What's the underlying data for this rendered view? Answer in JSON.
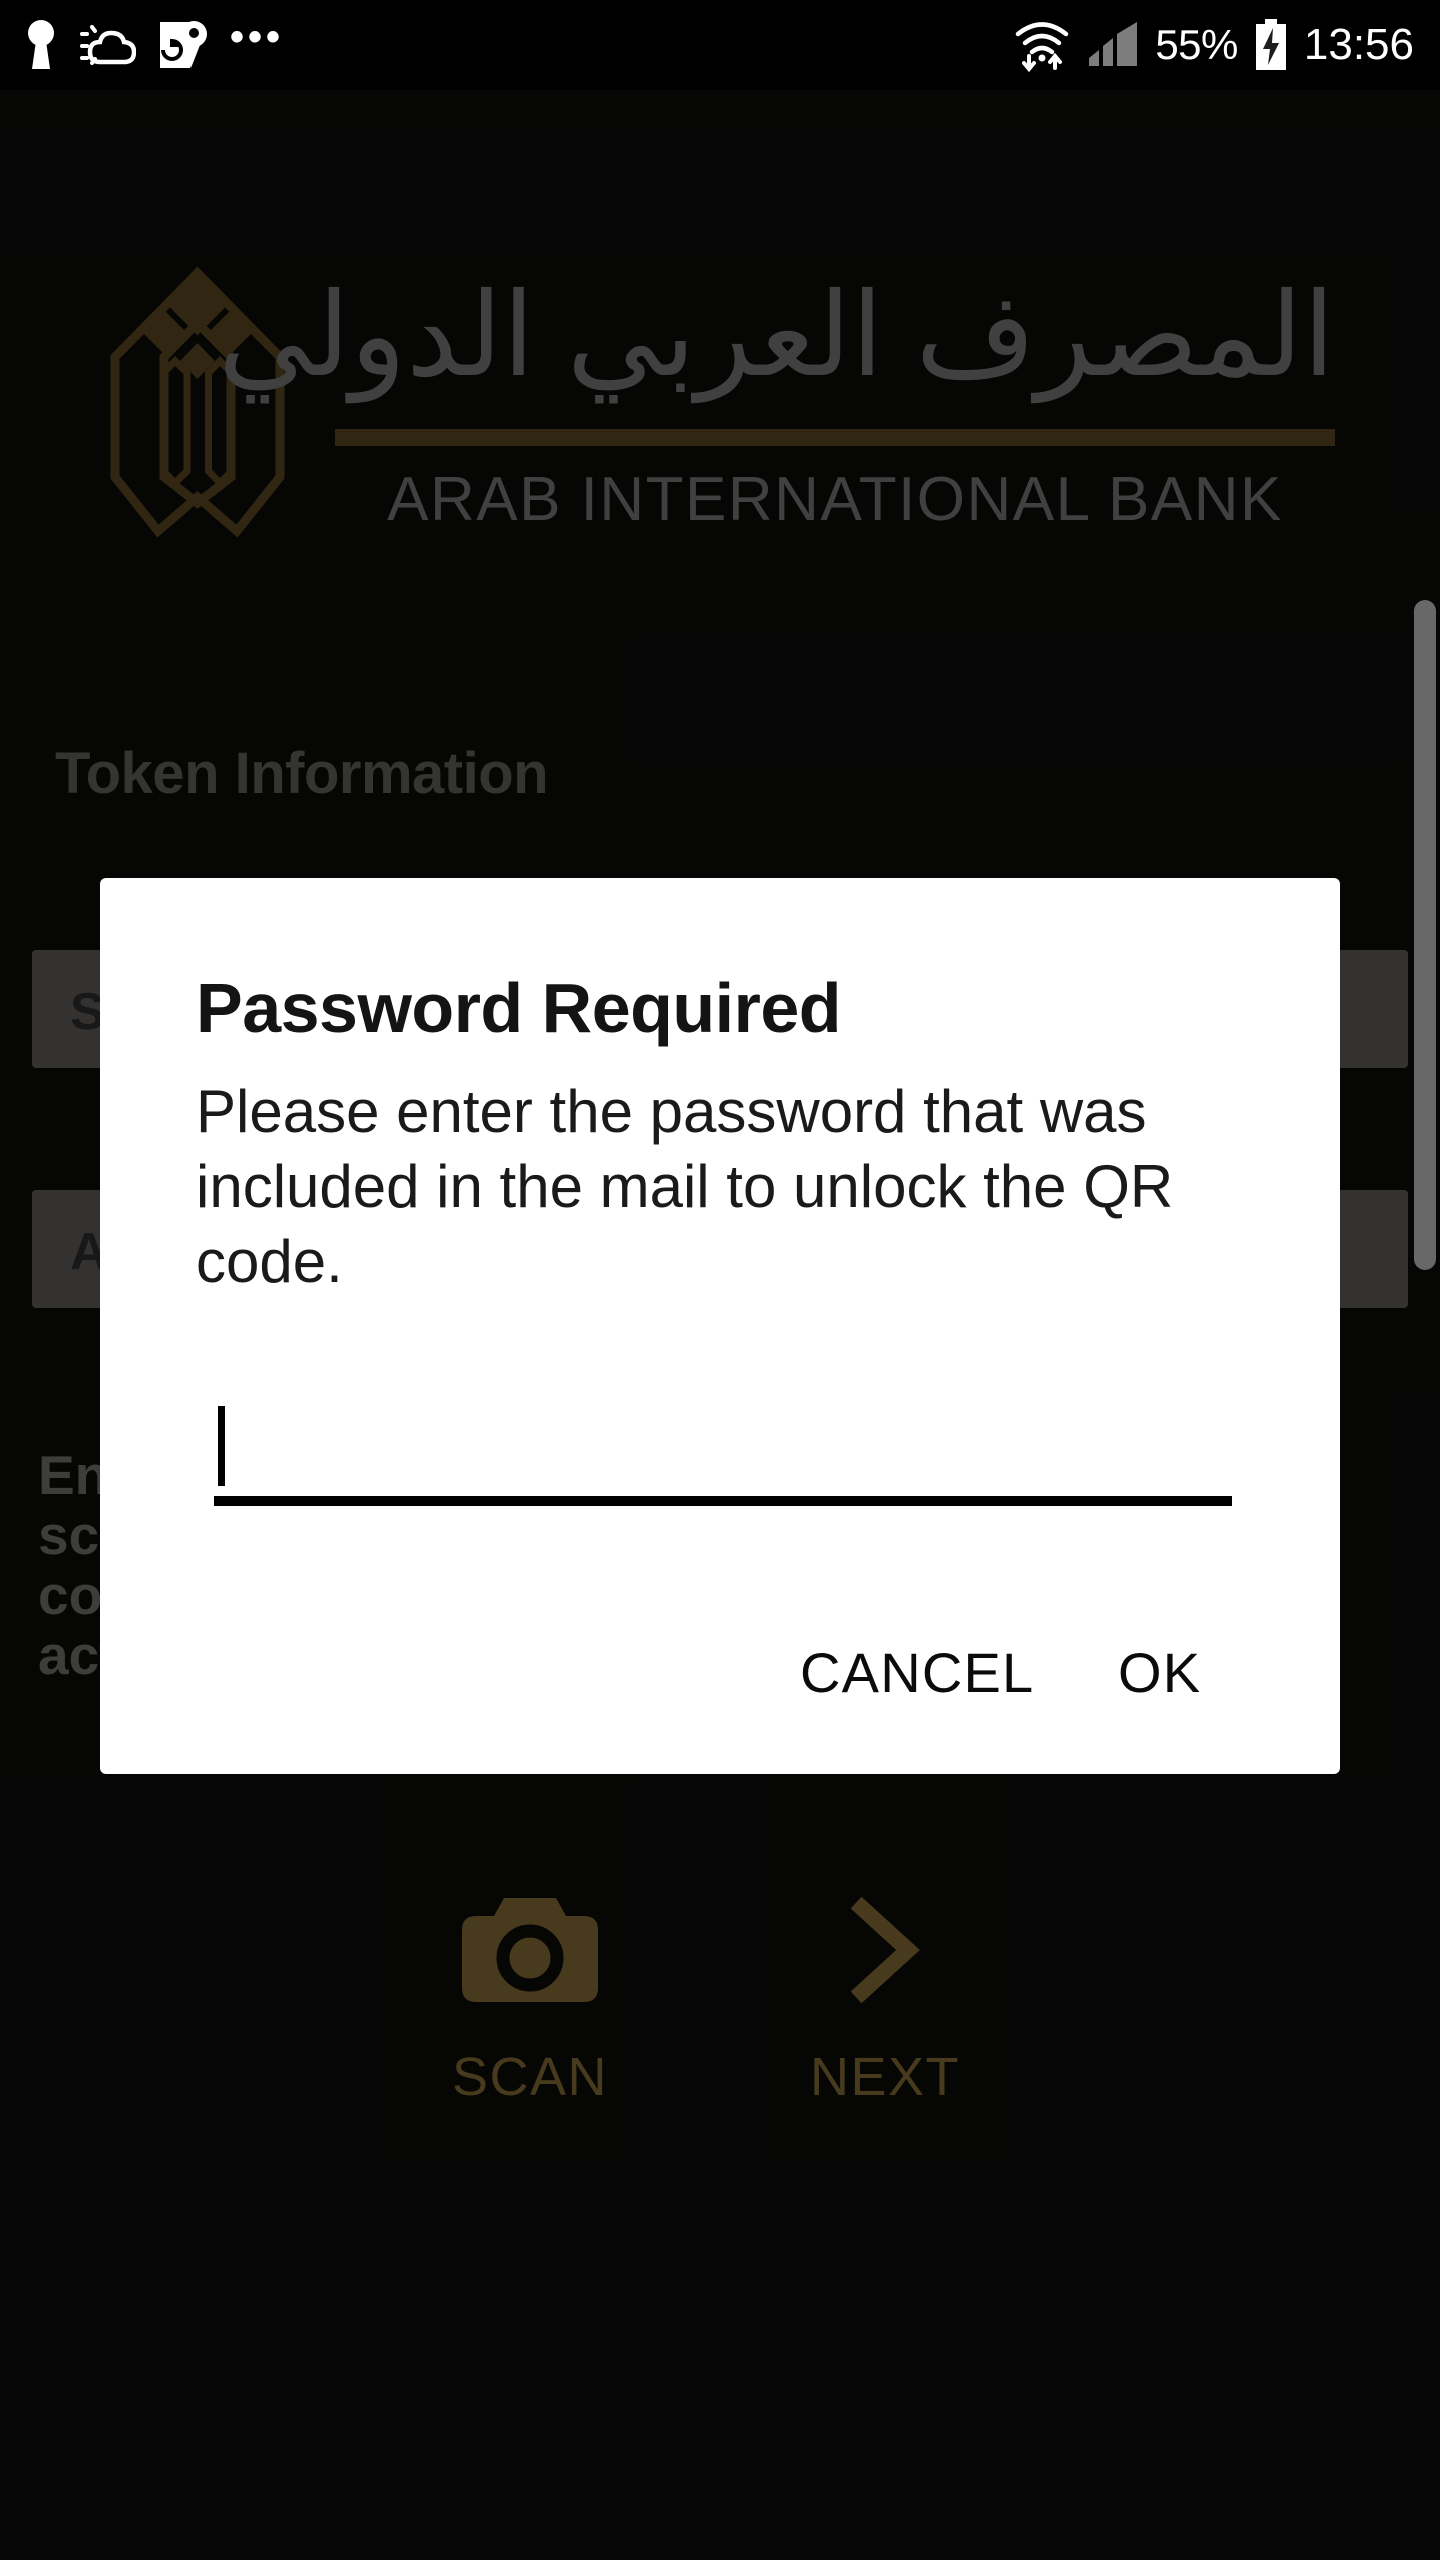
{
  "statusbar": {
    "left_icons": [
      {
        "name": "keyhole-icon",
        "label": "keyhole"
      },
      {
        "name": "weather-partly-cloudy-icon",
        "label": "weather"
      },
      {
        "name": "google-maps-icon",
        "label": "maps"
      }
    ],
    "overflow": "•••",
    "wifi_icon": "wifi-icon",
    "signal_icon": "cellular-signal-icon",
    "battery_percent": "55%",
    "battery_icon": "battery-charging-icon",
    "clock": "13:56",
    "background": "#000000",
    "foreground": "#ffffff"
  },
  "brand": {
    "emblem_name": "arab-international-bank-emblem",
    "arabic_name": "المصرف العربي الدولي",
    "english_name": "ARAB INTERNATIONAL BANK",
    "gold": "#53421f",
    "text_gray": "#6f6f6f"
  },
  "page": {
    "section_title": "Token Information",
    "field_one_label": "S",
    "field_two_label": "A",
    "body_text": "Ent\nsca\ncon\nact"
  },
  "actions": {
    "scan": {
      "label": "SCAN",
      "icon": "camera-icon"
    },
    "next": {
      "label": "NEXT",
      "icon": "chevron-right-icon"
    },
    "color": "#7a6432"
  },
  "dialog": {
    "title": "Password Required",
    "message": "Please enter the password that was included in the mail to unlock the QR code.",
    "input": {
      "value": "",
      "placeholder": ""
    },
    "cancel_label": "CANCEL",
    "ok_label": "OK",
    "background": "#ffffff",
    "text_color": "#141414"
  }
}
